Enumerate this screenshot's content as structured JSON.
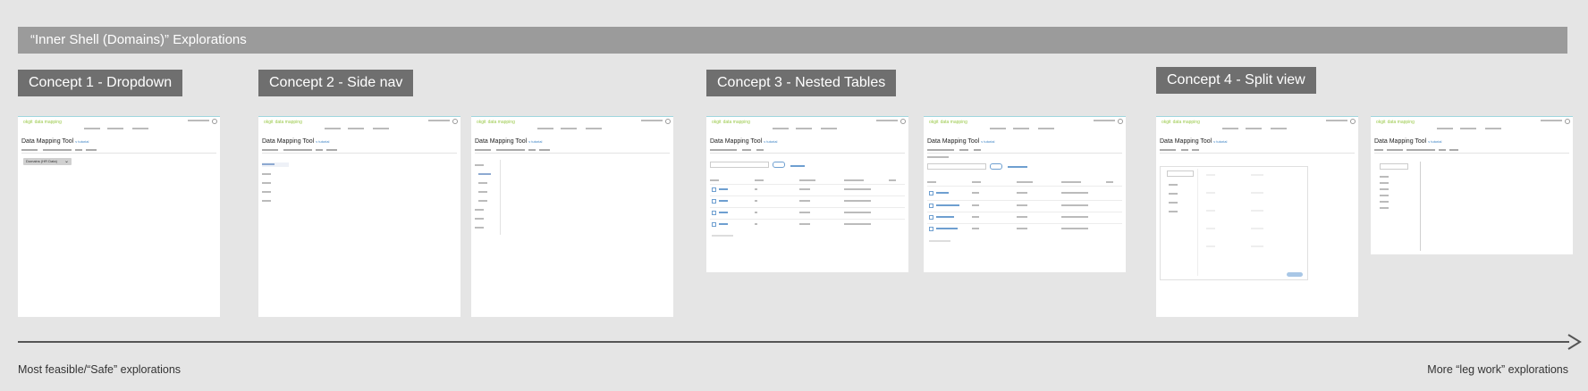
{
  "banner": {
    "title": "“Inner Shell (Domains)” Explorations"
  },
  "concepts": [
    {
      "label": "Concept 1 - Dropdown"
    },
    {
      "label": "Concept 2 - Side nav"
    },
    {
      "label": "Concept 3 - Nested Tables"
    },
    {
      "label": "Concept 4 - Split view"
    }
  ],
  "mockup": {
    "logo": "okgit",
    "logo_sub": "data mapping",
    "page_title": "Data Mapping Tool",
    "page_title_link": "v tutorial",
    "dropdown_value": "Domains (HR Data)"
  },
  "axis": {
    "left_label": "Most feasible/“Safe” explorations",
    "right_label": "More “leg work” explorations"
  },
  "colors": {
    "background": "#e5e5e5",
    "banner": "#9b9b9b",
    "concept_label": "#6f6f6f",
    "accent_link": "#3b82c4"
  }
}
